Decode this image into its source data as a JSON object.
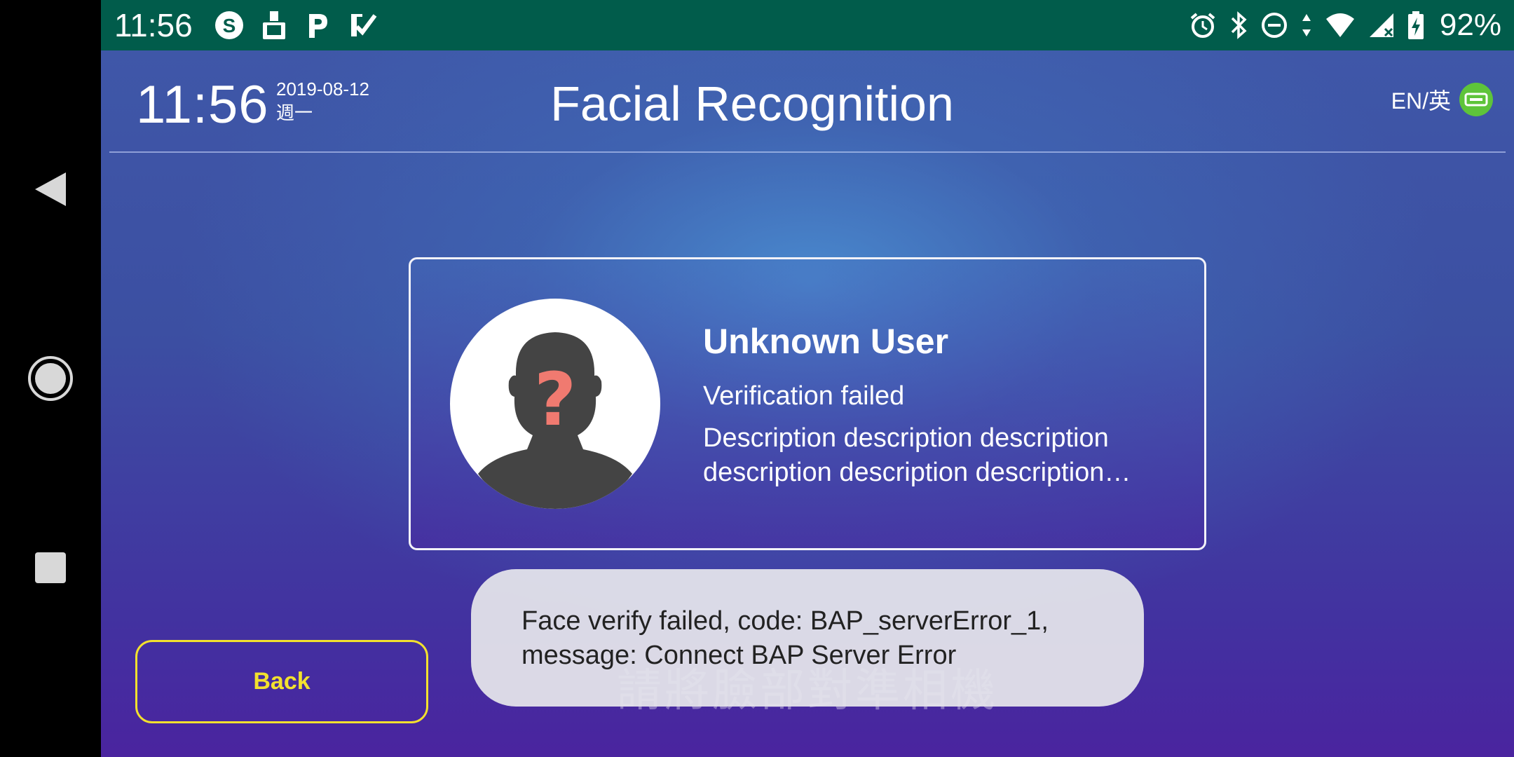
{
  "status_bar": {
    "time": "11:56",
    "battery_percent": "92%",
    "left_icons": [
      "s-circle-icon",
      "cleaner-icon",
      "p-app-icon",
      "checklist-icon"
    ],
    "right_icons": [
      "alarm-icon",
      "bluetooth-icon",
      "dnd-icon",
      "data-arrows-icon",
      "wifi-icon",
      "signal-icon",
      "battery-charging-icon"
    ],
    "color": "#015c4b"
  },
  "header": {
    "time": "11:56",
    "date": "2019-08-12",
    "weekday": "週一",
    "title": "Facial Recognition",
    "language_label": "EN/英",
    "language_toggle_color": "#5ec43a"
  },
  "card": {
    "user_name": "Unknown User",
    "status": "Verification failed",
    "description": "Description description description description description description description",
    "avatar_mark": "?"
  },
  "back_button": {
    "label": "Back",
    "color": "#f3e12e"
  },
  "hint": {
    "text": "請將臉部對準相機"
  },
  "toast": {
    "line1": "Face verify failed, code: BAP_serverError_1,",
    "line2": "message: Connect BAP Server Error"
  },
  "nav": {
    "back": "back-triangle-icon",
    "home": "home-circle-icon",
    "recents": "recents-square-icon"
  }
}
